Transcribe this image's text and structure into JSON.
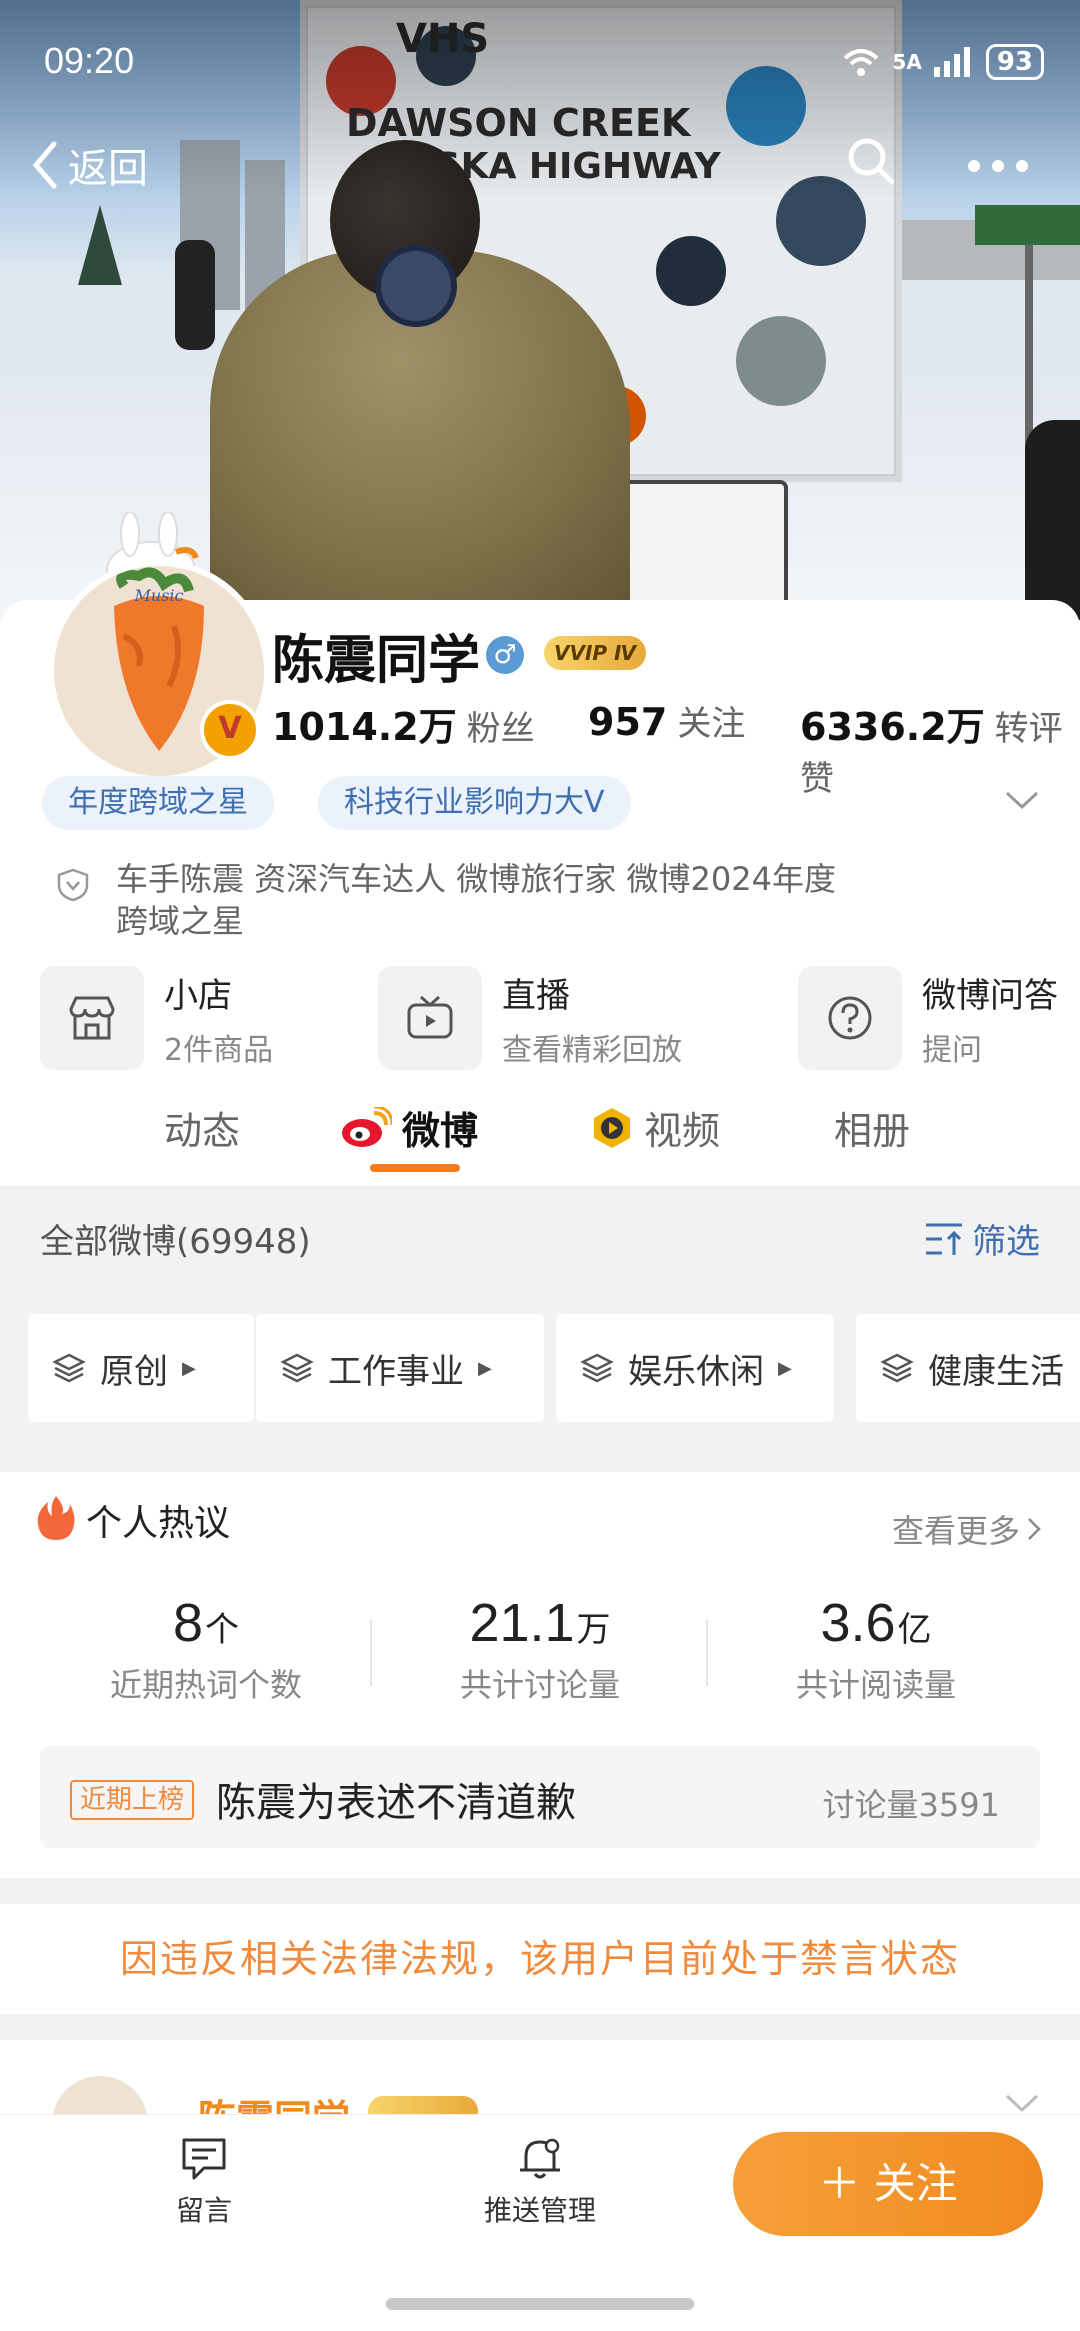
{
  "status_bar": {
    "time": "09:20",
    "network": "5A",
    "battery": "93"
  },
  "nav": {
    "back_label": "返回"
  },
  "profile": {
    "name": "陈震同学",
    "vip_label": "VVIP Ⅳ",
    "verified_badge": "V",
    "stats": [
      {
        "value": "1014.2万",
        "label": "粉丝"
      },
      {
        "value": "957",
        "label": "关注"
      },
      {
        "value": "6336.2万",
        "label": "转评赞"
      }
    ],
    "tags": [
      "年度跨域之星",
      "科技行业影响力大V"
    ],
    "bio_line1": "车手陈震 资深汽车达人  微博旅行家  微博2024年度",
    "bio_line2": "跨域之星"
  },
  "services": [
    {
      "title": "小店",
      "subtitle": "2件商品",
      "icon": "shop-icon"
    },
    {
      "title": "直播",
      "subtitle": "查看精彩回放",
      "icon": "tv-icon"
    },
    {
      "title": "微博问答",
      "subtitle": "提问",
      "icon": "question-icon"
    }
  ],
  "tabs": [
    "动态",
    "微博",
    "视频",
    "相册"
  ],
  "active_tab": "微博",
  "feed": {
    "all_count_label": "全部微博(69948)",
    "filter_label": "筛选",
    "categories": [
      "原创",
      "工作事业",
      "娱乐休闲",
      "健康生活"
    ]
  },
  "hot": {
    "title": "个人热议",
    "see_more": "查看更多",
    "metrics": [
      {
        "value": "8",
        "unit": "个",
        "caption": "近期热词个数"
      },
      {
        "value": "21.1",
        "unit": "万",
        "caption": "共计讨论量"
      },
      {
        "value": "3.6",
        "unit": "亿",
        "caption": "共计阅读量"
      }
    ],
    "recent_tag": "近期上榜",
    "recent_topic": "陈震为表述不清道歉",
    "recent_count": "讨论量3591"
  },
  "notice": "因违反相关法律法规，该用户目前处于禁言状态",
  "post_peek": {
    "name": "陈震同学"
  },
  "bottom_bar": {
    "message": "留言",
    "push": "推送管理",
    "follow": "＋ 关注"
  },
  "colors": {
    "accent_orange": "#f08a1f",
    "link_blue": "#3f6fb0"
  }
}
